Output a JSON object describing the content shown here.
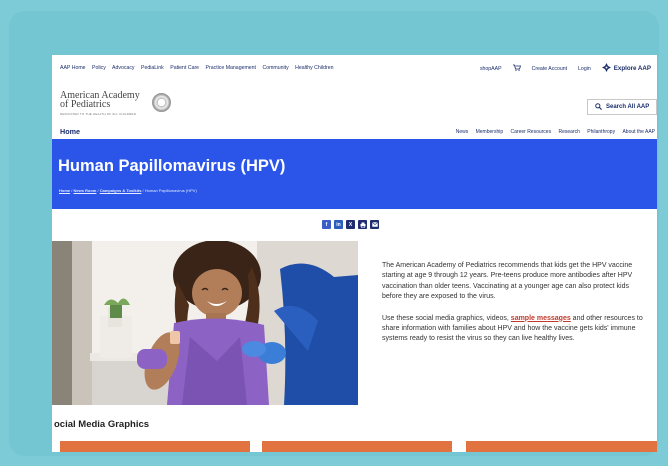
{
  "utility_nav": {
    "links": [
      "AAP Home",
      "Policy",
      "Advocacy",
      "PediaLink",
      "Patient Care",
      "Practice Management",
      "Community",
      "Healthy Children"
    ],
    "shop": "shopAAP",
    "create_account": "Create Account",
    "login": "Login",
    "explore": "Explore AAP"
  },
  "logo": {
    "line1": "American Academy",
    "line2": "of Pediatrics",
    "tagline": "DEDICATED TO THE HEALTH OF ALL CHILDREN"
  },
  "search": {
    "label": "Search All AAP"
  },
  "main_nav": {
    "home": "Home",
    "items": [
      "News",
      "Membership",
      "Career Resources",
      "Research",
      "Philanthropy",
      "About the AAP"
    ]
  },
  "banner": {
    "title": "Human Papillomavirus (HPV)",
    "breadcrumb": [
      "Home",
      "News Room",
      "Campaigns & Toolkits",
      "Human Papillomavirus (HPV)"
    ]
  },
  "intro": {
    "p1": "The American Academy of Pediatrics recommends that kids get the HPV vaccine starting at age 9 through 12 years. Pre-teens produce more antibodies after HPV vaccination than older teens. Vaccinating at a younger age can also protect kids before they are exposed to the virus.",
    "p2_before": "Use these social media graphics, videos, ",
    "p2_link": "sample messages",
    "p2_after": " and other resources to share information with families about HPV and how the vaccine gets kids' immune systems ready to resist the virus so they can live healthy lives."
  },
  "section": {
    "title": "ocial Media Graphics"
  },
  "colors": {
    "banner": "#2b55e8",
    "navy": "#1a2d6b",
    "frame": "#74c7d2",
    "tile": "#e0733f"
  }
}
